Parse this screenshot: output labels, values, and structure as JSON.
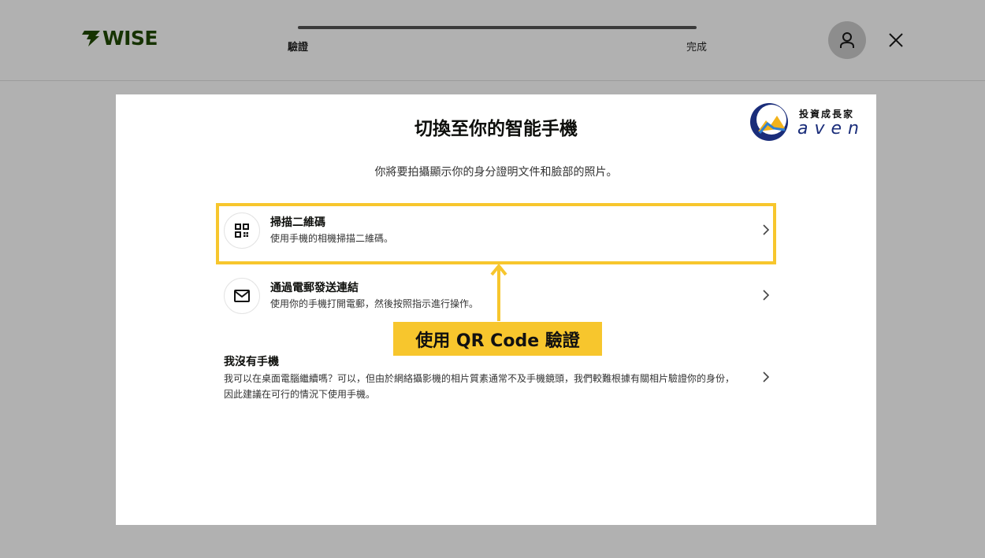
{
  "header": {
    "logo_text": "WISE",
    "steps": [
      "驗證",
      "完成"
    ],
    "avatar_icon": "user-icon",
    "close_icon": "close-icon"
  },
  "brand": {
    "name": "投資成長家",
    "sub": "aven"
  },
  "card": {
    "title": "切換至你的智能手機",
    "subtitle": "你將要拍攝顯示你的身分證明文件和臉部的照片。",
    "options": [
      {
        "icon": "qr-code-icon",
        "title": "掃描二維碼",
        "desc": "使用手機的相機掃描二維碼。"
      },
      {
        "icon": "mail-icon",
        "title": "通過電郵發送連結",
        "desc": "使用你的手機打開電郵，然後按照指示進行操作。"
      }
    ],
    "no_phone": {
      "title": "我沒有手機",
      "desc": "我可以在桌面電腦繼續嗎？可以，但由於網絡攝影機的相片質素通常不及手機鏡頭，我們較難根據有關相片驗證你的身份，因此建議在可行的情況下使用手機。"
    }
  },
  "annotation": {
    "text": "使用 QR Code 驗證",
    "color": "#f7c62d"
  }
}
